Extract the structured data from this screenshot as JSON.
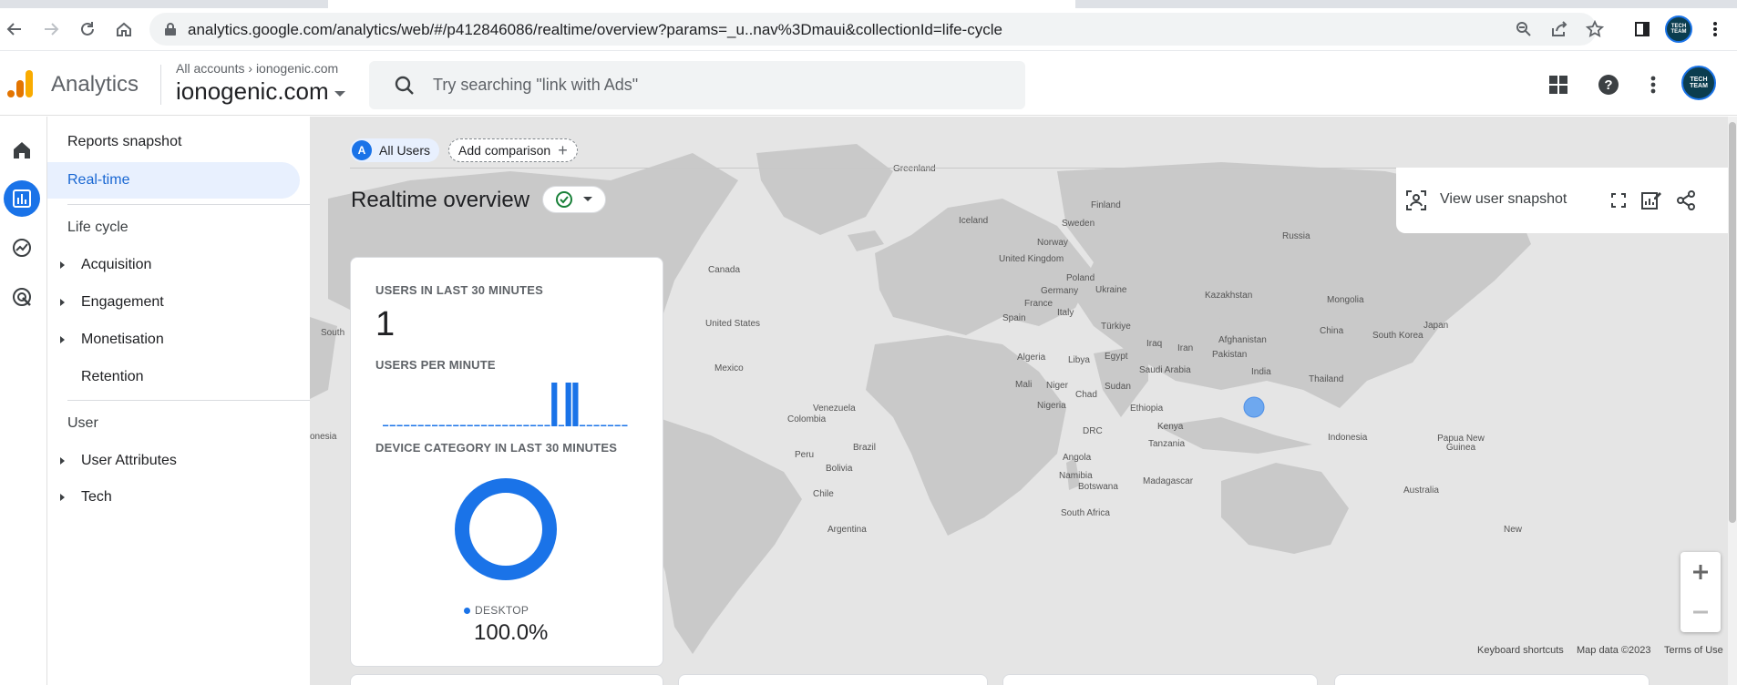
{
  "browser": {
    "url": "analytics.google.com/analytics/web/#/p412846086/realtime/overview?params=_u..nav%3Dmaui&collectionId=life-cycle",
    "profile_text": "TECH TEAM"
  },
  "header": {
    "app_title": "Analytics",
    "breadcrumb_accounts": "All accounts",
    "breadcrumb_property": "ionogenic.com",
    "property_name": "ionogenic.com",
    "search_placeholder": "Try searching \"link with Ads\"",
    "avatar_text": "TECH TEAM"
  },
  "sidenav": {
    "reports_snapshot": "Reports snapshot",
    "realtime": "Real-time",
    "life_cycle": {
      "title": "Life cycle",
      "items": [
        "Acquisition",
        "Engagement",
        "Monetisation",
        "Retention"
      ]
    },
    "user": {
      "title": "User",
      "items": [
        "User Attributes",
        "Tech"
      ]
    }
  },
  "main": {
    "comparison_chip": "All Users",
    "comparison_chip_letter": "A",
    "add_comparison": "Add comparison",
    "title": "Realtime overview",
    "view_user_snapshot": "View user snapshot",
    "attribution": {
      "shortcuts": "Keyboard shortcuts",
      "map_data": "Map data ©2023",
      "terms": "Terms of Use"
    }
  },
  "card": {
    "users_label": "USERS IN LAST 30 MINUTES",
    "users_value": "1",
    "per_minute_label": "USERS PER MINUTE",
    "device_label": "DEVICE CATEGORY IN LAST 30 MINUTES",
    "device_legend": "DESKTOP",
    "device_pct": "100.0%"
  },
  "map_labels": [
    "Greenland",
    "Iceland",
    "Finland",
    "Sweden",
    "Norway",
    "Russia",
    "United Kingdom",
    "Poland",
    "Germany",
    "Ukraine",
    "Kazakhstan",
    "Mongolia",
    "France",
    "Italy",
    "Spain",
    "Türkiye",
    "China",
    "Japan",
    "South Korea",
    "Iraq",
    "Iran",
    "Afghanistan",
    "Pakistan",
    "Algeria",
    "Libya",
    "Egypt",
    "Saudi Arabia",
    "India",
    "Thailand",
    "Mali",
    "Niger",
    "Chad",
    "Sudan",
    "Nigeria",
    "Ethiopia",
    "Kenya",
    "DRC",
    "Tanzania",
    "Angola",
    "Namibia",
    "Botswana",
    "Madagascar",
    "South Africa",
    "Indonesia",
    "Papua New Guinea",
    "Australia",
    "Canada",
    "United States",
    "Mexico",
    "Venezuela",
    "Colombia",
    "Peru",
    "Brazil",
    "Bolivia",
    "Chile",
    "Argentina",
    "South",
    "onesia",
    "New"
  ],
  "chart_data": [
    {
      "type": "bar",
      "title": "USERS PER MINUTE",
      "values": [
        0,
        0,
        0,
        0,
        0,
        0,
        0,
        0,
        0,
        0,
        0,
        0,
        0,
        0,
        0,
        0,
        0,
        0,
        0,
        0,
        0,
        0,
        0,
        0,
        1,
        0,
        1,
        1,
        0,
        0,
        0,
        0,
        0,
        0,
        0
      ],
      "ylim": [
        0,
        1
      ]
    },
    {
      "type": "pie",
      "title": "DEVICE CATEGORY IN LAST 30 MINUTES",
      "categories": [
        "DESKTOP"
      ],
      "values": [
        100.0
      ]
    }
  ],
  "colors": {
    "accent": "#1a73e8",
    "active_nav_bg": "#e8f0fe",
    "map_bg": "#e5e5e5",
    "land": "#c9c9c9"
  }
}
